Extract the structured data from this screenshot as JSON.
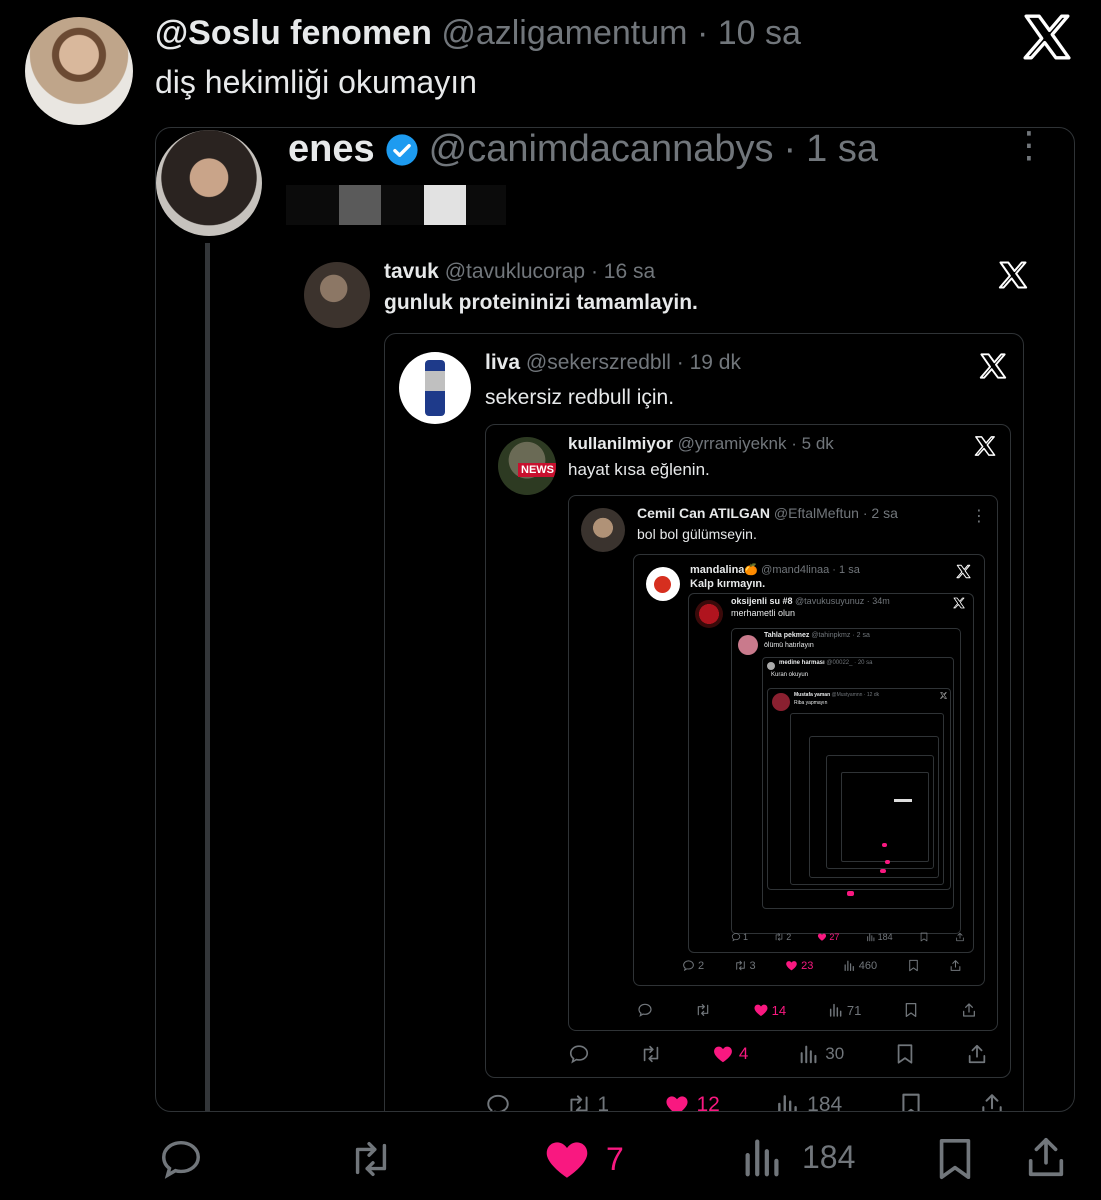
{
  "tweet": {
    "display_name": "@Soslu fenomen",
    "handle": "@azligamentum",
    "time": "10 sa",
    "text": "diş hekimliği okumayın"
  },
  "quoted": {
    "display_name": "enes",
    "handle": "@canimdacannabys",
    "time": "1 sa",
    "verified": true
  },
  "level1": {
    "display_name": "tavuk",
    "handle": "@tavuklucorap",
    "time": "16 sa",
    "text": "gunluk proteininizi tamamlayin.",
    "actions": {
      "retweets": "1",
      "likes": "12",
      "views": "184"
    }
  },
  "level2": {
    "display_name": "liva",
    "handle": "@sekerszredbll",
    "time": "19 dk",
    "text": "sekersiz redbull için."
  },
  "level3": {
    "display_name": "kullanilmiyor",
    "handle": "@yrramiyeknk",
    "time": "5 dk",
    "text": "hayat kısa eğlenin.",
    "avatar_label": "NEWS",
    "actions": {
      "likes": "4",
      "views": "30"
    }
  },
  "level4": {
    "display_name": "Cemil Can ATILGAN",
    "handle": "@EftalMeftun",
    "time": "2 sa",
    "text": "bol bol gülümseyin.",
    "actions": {
      "likes": "14",
      "views": "71"
    }
  },
  "level5": {
    "display_name": "mandalina🍊",
    "handle": "@mand4linaa",
    "time": "1 sa",
    "text": "Kalp kırmayın.",
    "actions": {
      "replies": "2",
      "retweets": "3",
      "likes": "23",
      "views": "460"
    }
  },
  "level6": {
    "display_name": "oksijenli su #8",
    "handle": "@tavukusuyunuz",
    "time": "34m",
    "text": "merhametli olun",
    "actions": {
      "replies": "1",
      "retweets": "2",
      "likes": "27",
      "views": "184"
    }
  },
  "level7": {
    "display_name": "Tahla pekmez",
    "handle": "@tahinpkmz",
    "time": "2 sa",
    "text": "ölümü hatırlayın"
  },
  "level8": {
    "display_name": "medine harması",
    "handle": "@00022_",
    "time": "20 sa",
    "text": "Kuran okuyun"
  },
  "level9": {
    "display_name": "Mustafa yaman",
    "handle": "@Mustyamnn",
    "time": "12 dk",
    "text": "Riba yapmayın"
  },
  "actions": {
    "likes": "7",
    "views": "184"
  },
  "colors": {
    "background": "#000000",
    "like_pink": "#f91880",
    "verified_blue": "#1d9bf0",
    "muted": "#71767b"
  },
  "icons": [
    "x-logo-icon",
    "verified-badge-icon",
    "more-dots-icon",
    "reply-icon",
    "retweet-icon",
    "heart-icon",
    "views-icon",
    "bookmark-icon",
    "share-icon"
  ]
}
